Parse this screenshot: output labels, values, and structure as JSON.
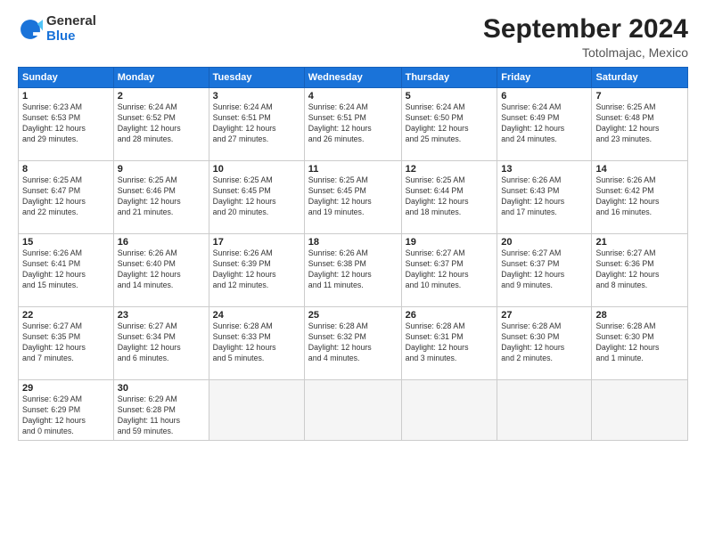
{
  "header": {
    "logo_line1": "General",
    "logo_line2": "Blue",
    "month": "September 2024",
    "location": "Totolmajac, Mexico"
  },
  "weekdays": [
    "Sunday",
    "Monday",
    "Tuesday",
    "Wednesday",
    "Thursday",
    "Friday",
    "Saturday"
  ],
  "weeks": [
    [
      {
        "day": "1",
        "lines": [
          "Sunrise: 6:23 AM",
          "Sunset: 6:53 PM",
          "Daylight: 12 hours",
          "and 29 minutes."
        ]
      },
      {
        "day": "2",
        "lines": [
          "Sunrise: 6:24 AM",
          "Sunset: 6:52 PM",
          "Daylight: 12 hours",
          "and 28 minutes."
        ]
      },
      {
        "day": "3",
        "lines": [
          "Sunrise: 6:24 AM",
          "Sunset: 6:51 PM",
          "Daylight: 12 hours",
          "and 27 minutes."
        ]
      },
      {
        "day": "4",
        "lines": [
          "Sunrise: 6:24 AM",
          "Sunset: 6:51 PM",
          "Daylight: 12 hours",
          "and 26 minutes."
        ]
      },
      {
        "day": "5",
        "lines": [
          "Sunrise: 6:24 AM",
          "Sunset: 6:50 PM",
          "Daylight: 12 hours",
          "and 25 minutes."
        ]
      },
      {
        "day": "6",
        "lines": [
          "Sunrise: 6:24 AM",
          "Sunset: 6:49 PM",
          "Daylight: 12 hours",
          "and 24 minutes."
        ]
      },
      {
        "day": "7",
        "lines": [
          "Sunrise: 6:25 AM",
          "Sunset: 6:48 PM",
          "Daylight: 12 hours",
          "and 23 minutes."
        ]
      }
    ],
    [
      {
        "day": "8",
        "lines": [
          "Sunrise: 6:25 AM",
          "Sunset: 6:47 PM",
          "Daylight: 12 hours",
          "and 22 minutes."
        ]
      },
      {
        "day": "9",
        "lines": [
          "Sunrise: 6:25 AM",
          "Sunset: 6:46 PM",
          "Daylight: 12 hours",
          "and 21 minutes."
        ]
      },
      {
        "day": "10",
        "lines": [
          "Sunrise: 6:25 AM",
          "Sunset: 6:45 PM",
          "Daylight: 12 hours",
          "and 20 minutes."
        ]
      },
      {
        "day": "11",
        "lines": [
          "Sunrise: 6:25 AM",
          "Sunset: 6:45 PM",
          "Daylight: 12 hours",
          "and 19 minutes."
        ]
      },
      {
        "day": "12",
        "lines": [
          "Sunrise: 6:25 AM",
          "Sunset: 6:44 PM",
          "Daylight: 12 hours",
          "and 18 minutes."
        ]
      },
      {
        "day": "13",
        "lines": [
          "Sunrise: 6:26 AM",
          "Sunset: 6:43 PM",
          "Daylight: 12 hours",
          "and 17 minutes."
        ]
      },
      {
        "day": "14",
        "lines": [
          "Sunrise: 6:26 AM",
          "Sunset: 6:42 PM",
          "Daylight: 12 hours",
          "and 16 minutes."
        ]
      }
    ],
    [
      {
        "day": "15",
        "lines": [
          "Sunrise: 6:26 AM",
          "Sunset: 6:41 PM",
          "Daylight: 12 hours",
          "and 15 minutes."
        ]
      },
      {
        "day": "16",
        "lines": [
          "Sunrise: 6:26 AM",
          "Sunset: 6:40 PM",
          "Daylight: 12 hours",
          "and 14 minutes."
        ]
      },
      {
        "day": "17",
        "lines": [
          "Sunrise: 6:26 AM",
          "Sunset: 6:39 PM",
          "Daylight: 12 hours",
          "and 12 minutes."
        ]
      },
      {
        "day": "18",
        "lines": [
          "Sunrise: 6:26 AM",
          "Sunset: 6:38 PM",
          "Daylight: 12 hours",
          "and 11 minutes."
        ]
      },
      {
        "day": "19",
        "lines": [
          "Sunrise: 6:27 AM",
          "Sunset: 6:37 PM",
          "Daylight: 12 hours",
          "and 10 minutes."
        ]
      },
      {
        "day": "20",
        "lines": [
          "Sunrise: 6:27 AM",
          "Sunset: 6:37 PM",
          "Daylight: 12 hours",
          "and 9 minutes."
        ]
      },
      {
        "day": "21",
        "lines": [
          "Sunrise: 6:27 AM",
          "Sunset: 6:36 PM",
          "Daylight: 12 hours",
          "and 8 minutes."
        ]
      }
    ],
    [
      {
        "day": "22",
        "lines": [
          "Sunrise: 6:27 AM",
          "Sunset: 6:35 PM",
          "Daylight: 12 hours",
          "and 7 minutes."
        ]
      },
      {
        "day": "23",
        "lines": [
          "Sunrise: 6:27 AM",
          "Sunset: 6:34 PM",
          "Daylight: 12 hours",
          "and 6 minutes."
        ]
      },
      {
        "day": "24",
        "lines": [
          "Sunrise: 6:28 AM",
          "Sunset: 6:33 PM",
          "Daylight: 12 hours",
          "and 5 minutes."
        ]
      },
      {
        "day": "25",
        "lines": [
          "Sunrise: 6:28 AM",
          "Sunset: 6:32 PM",
          "Daylight: 12 hours",
          "and 4 minutes."
        ]
      },
      {
        "day": "26",
        "lines": [
          "Sunrise: 6:28 AM",
          "Sunset: 6:31 PM",
          "Daylight: 12 hours",
          "and 3 minutes."
        ]
      },
      {
        "day": "27",
        "lines": [
          "Sunrise: 6:28 AM",
          "Sunset: 6:30 PM",
          "Daylight: 12 hours",
          "and 2 minutes."
        ]
      },
      {
        "day": "28",
        "lines": [
          "Sunrise: 6:28 AM",
          "Sunset: 6:30 PM",
          "Daylight: 12 hours",
          "and 1 minute."
        ]
      }
    ],
    [
      {
        "day": "29",
        "lines": [
          "Sunrise: 6:29 AM",
          "Sunset: 6:29 PM",
          "Daylight: 12 hours",
          "and 0 minutes."
        ]
      },
      {
        "day": "30",
        "lines": [
          "Sunrise: 6:29 AM",
          "Sunset: 6:28 PM",
          "Daylight: 11 hours",
          "and 59 minutes."
        ]
      },
      {
        "day": "",
        "lines": []
      },
      {
        "day": "",
        "lines": []
      },
      {
        "day": "",
        "lines": []
      },
      {
        "day": "",
        "lines": []
      },
      {
        "day": "",
        "lines": []
      }
    ]
  ]
}
